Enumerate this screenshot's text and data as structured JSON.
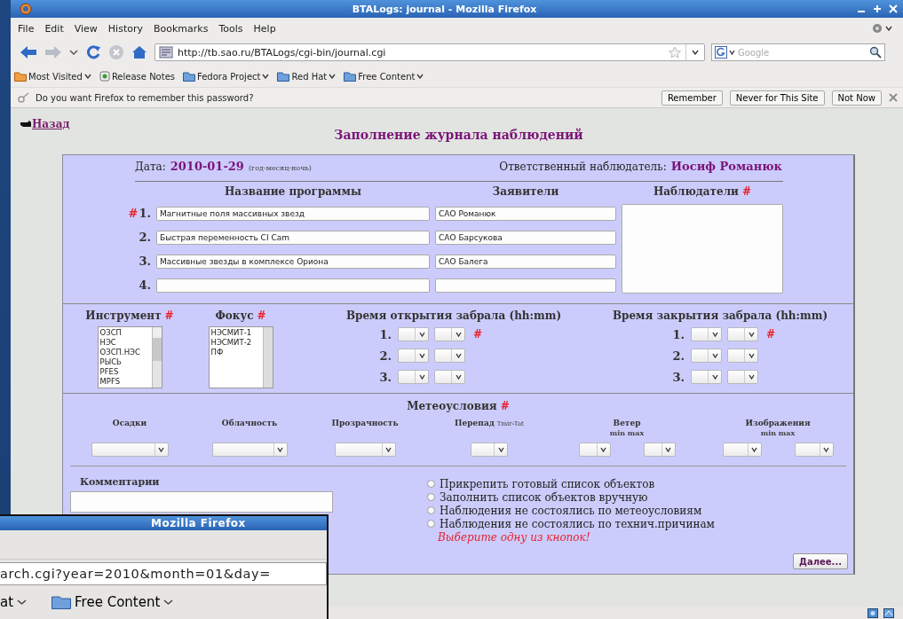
{
  "main_window": {
    "title": "BTALogs: journal - Mozilla Firefox",
    "menu": [
      "File",
      "Edit",
      "View",
      "History",
      "Bookmarks",
      "Tools",
      "Help"
    ],
    "address": "http://tb.sao.ru/BTALogs/cgi-bin/journal.cgi",
    "search_placeholder": "Google",
    "bookmarks": [
      {
        "label": "Most Visited",
        "kind": "smart",
        "dropdown": true
      },
      {
        "label": "Release Notes",
        "kind": "page",
        "dropdown": false
      },
      {
        "label": "Fedora Project",
        "kind": "folder",
        "dropdown": true
      },
      {
        "label": "Red Hat",
        "kind": "folder",
        "dropdown": true
      },
      {
        "label": "Free Content",
        "kind": "folder",
        "dropdown": true
      }
    ],
    "password_bar": {
      "message": "Do you want Firefox to remember this password?",
      "buttons": [
        "Remember",
        "Never for This Site",
        "Not Now"
      ]
    },
    "page": {
      "back_link": "Назад",
      "heading": "Заполнение журнала наблюдений",
      "date_label": "Дата:",
      "date": "2010-01-29",
      "date_hint": "(год-месяц-ночь)",
      "observer_label": "Ответственный наблюдатель:",
      "observer": "Иосиф Романюк",
      "columns": [
        {
          "label": "Название программы"
        },
        {
          "label": "Заявители"
        },
        {
          "label": "Наблюдатели",
          "mark": "#"
        }
      ],
      "programs": [
        {
          "number": "1.",
          "mark": "#",
          "name": "Магнитные поля массивных звезд",
          "applicant": "САО Романюк"
        },
        {
          "number": "2.",
          "name": "Быстрая переменность CI Cam",
          "applicant": "САО Барсукова"
        },
        {
          "number": "3.",
          "name": "Массивные звезды в комплексе Ориона",
          "applicant": "САО Балега"
        },
        {
          "number": "4."
        }
      ],
      "instrument": {
        "label": "Инструмент",
        "mark": "#",
        "options": [
          "ОЗСП",
          "НЭС",
          "ОЗСП.НЭС",
          "РЫСЬ",
          "PFES",
          "MPFS"
        ]
      },
      "focus": {
        "label": "Фокус",
        "mark": "#",
        "options": [
          "НЭСМИТ-1",
          "НЭСМИТ-2",
          "ПФ"
        ]
      },
      "opening": {
        "label": "Время открытия забрала (hh:mm)",
        "rows": [
          {
            "number": "1.",
            "mark": "#"
          },
          {
            "number": "2."
          },
          {
            "number": "3."
          }
        ]
      },
      "closing": {
        "label": "Время закрытия забрала (hh:mm)",
        "rows": [
          {
            "number": "1.",
            "mark": "#"
          },
          {
            "number": "2."
          },
          {
            "number": "3."
          }
        ]
      },
      "meteo": {
        "label": "Метеоусловия",
        "mark": "#",
        "fields": [
          {
            "label": "Осадки",
            "kind": "single"
          },
          {
            "label": "Облачность",
            "kind": "single"
          },
          {
            "label": "Прозрачность",
            "kind": "single"
          },
          {
            "label": "Перепад",
            "note": "Tmir-Tat",
            "kind": "single"
          },
          {
            "label": "Ветер",
            "sublabel": "min max",
            "kind": "range"
          },
          {
            "label": "Изображения",
            "sublabel": "min max",
            "kind": "range"
          }
        ]
      },
      "comments_label": "Комментарии",
      "radios": [
        {
          "label": "Прикрепить готовый список объектов",
          "selected": false
        },
        {
          "label": "Заполнить список объектов вручную",
          "selected": false
        },
        {
          "label": "Наблюдения не состоялись по метеоусловиям",
          "selected": false
        },
        {
          "label": "Наблюдения не состоялись по технич.причинам",
          "selected": false
        }
      ],
      "warning": "Выберите одну из кнопок!",
      "next_button": "Далее..."
    }
  },
  "front_window": {
    "title": "Mozilla Firefox",
    "address": "arch.cgi?year=2010&month=01&day=",
    "bookmarks": [
      {
        "label": "at",
        "dropdown": true
      },
      {
        "label": "Free Content",
        "kind": "folder",
        "dropdown": true
      }
    ]
  }
}
